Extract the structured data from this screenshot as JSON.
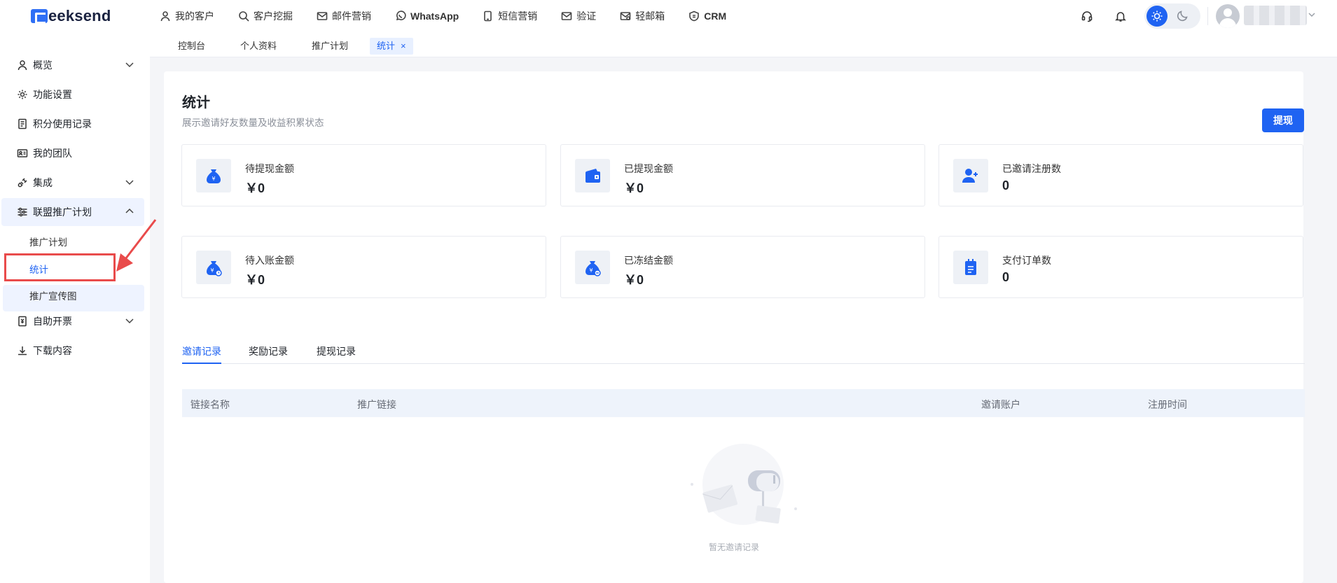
{
  "app": {
    "logo_text": "eeksend"
  },
  "topnav": [
    {
      "label": "我的客户",
      "icon": "user-icon"
    },
    {
      "label": "客户挖掘",
      "icon": "search-icon"
    },
    {
      "label": "邮件营销",
      "icon": "mail-icon"
    },
    {
      "label": "WhatsApp",
      "icon": "whatsapp-icon"
    },
    {
      "label": "短信营销",
      "icon": "sms-icon"
    },
    {
      "label": "验证",
      "icon": "verify-mail-icon"
    },
    {
      "label": "轻邮箱",
      "icon": "light-mail-icon"
    },
    {
      "label": "CRM",
      "icon": "crm-icon"
    }
  ],
  "tabs": [
    {
      "label": "控制台"
    },
    {
      "label": "个人资料"
    },
    {
      "label": "推广计划"
    },
    {
      "label": "统计",
      "close": "×"
    }
  ],
  "sidebar": {
    "items": [
      {
        "label": "概览",
        "icon": "user-icon"
      },
      {
        "label": "功能设置",
        "icon": "gear-icon"
      },
      {
        "label": "积分使用记录",
        "icon": "document-icon"
      },
      {
        "label": "我的团队",
        "icon": "id-card-icon"
      },
      {
        "label": "集成",
        "icon": "plug-icon"
      },
      {
        "label": "联盟推广计划",
        "icon": "sliders-icon"
      },
      {
        "label": "自助开票",
        "icon": "invoice-icon"
      },
      {
        "label": "下载内容",
        "icon": "download-icon"
      }
    ],
    "sub_items": [
      {
        "label": "推广计划"
      },
      {
        "label": "统计"
      },
      {
        "label": "推广宣传图"
      }
    ]
  },
  "page": {
    "title": "统计",
    "subtitle": "展示邀请好友数量及收益积累状态",
    "withdraw_label": "提现"
  },
  "stats": [
    {
      "label": "待提现金额",
      "value": "￥0",
      "icon": "money-bag-icon"
    },
    {
      "label": "已提现金额",
      "value": "￥0",
      "icon": "wallet-icon"
    },
    {
      "label": "已邀请注册数",
      "value": "0",
      "icon": "add-user-icon"
    },
    {
      "label": "待入账金额",
      "value": "￥0",
      "icon": "money-bag-clock-icon"
    },
    {
      "label": "已冻结金额",
      "value": "￥0",
      "icon": "money-bag-minus-icon"
    },
    {
      "label": "支付订单数",
      "value": "0",
      "icon": "clipboard-icon"
    }
  ],
  "record_tabs": [
    {
      "label": "邀请记录"
    },
    {
      "label": "奖励记录"
    },
    {
      "label": "提现记录"
    }
  ],
  "table": {
    "columns": [
      "链接名称",
      "推广链接",
      "邀请账户",
      "注册时间"
    ],
    "rows": [],
    "empty_text": "暂无邀请记录"
  },
  "colors": {
    "accent": "#1f63f2",
    "annotation": "#e94b4b"
  }
}
